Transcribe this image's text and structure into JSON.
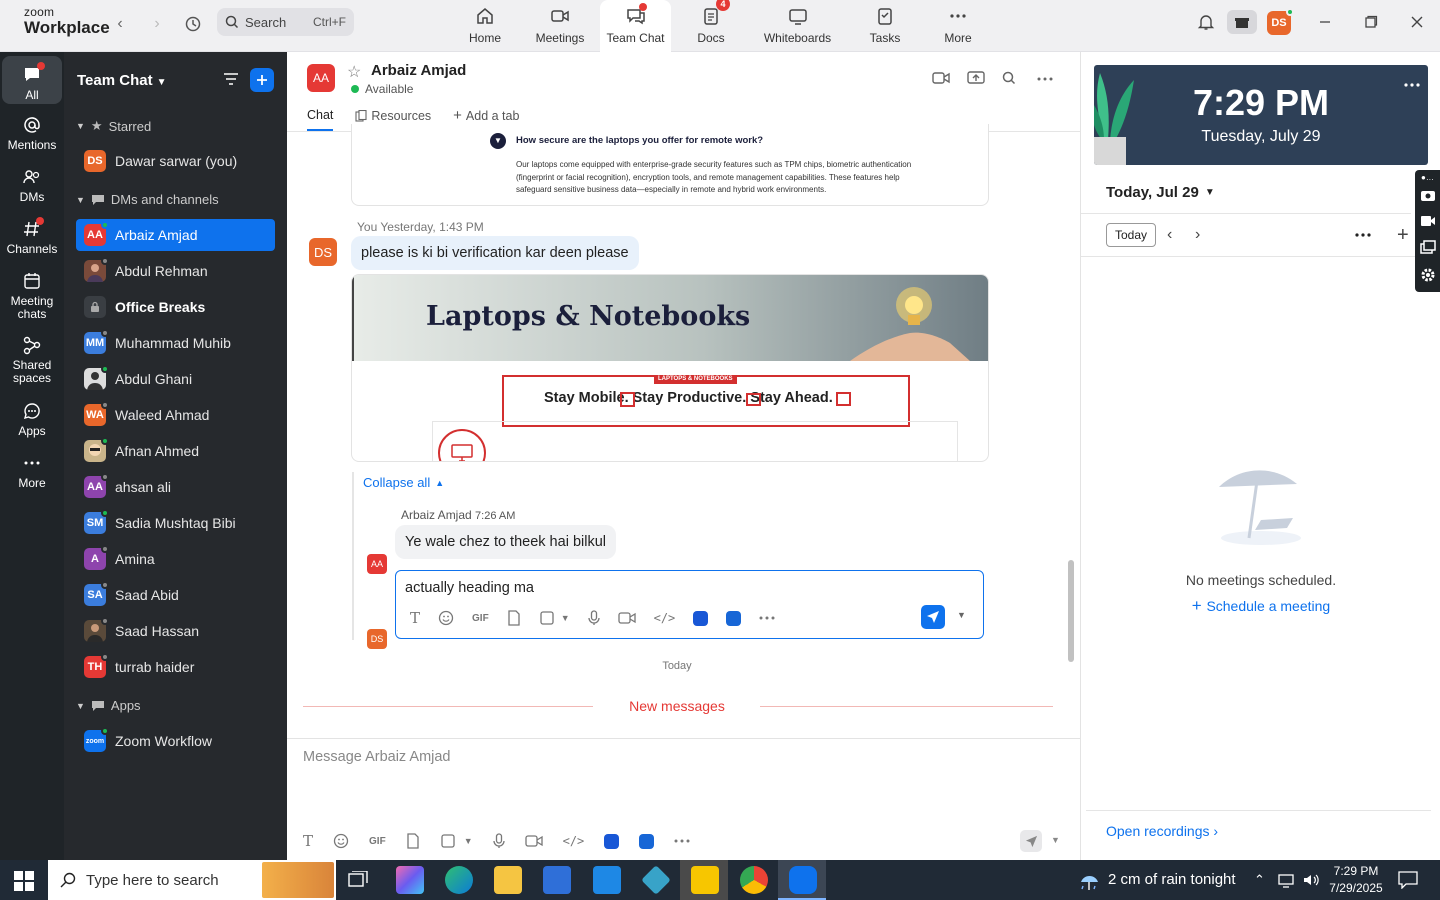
{
  "app": {
    "logo_line1": "zoom",
    "logo_line2": "Workplace",
    "search_placeholder": "Search",
    "search_shortcut": "Ctrl+F",
    "nav": [
      {
        "label": "Home"
      },
      {
        "label": "Meetings"
      },
      {
        "label": "Team Chat"
      },
      {
        "label": "Docs",
        "badge": "4"
      },
      {
        "label": "Whiteboards"
      },
      {
        "label": "Tasks"
      },
      {
        "label": "More"
      }
    ],
    "user_initials": "DS"
  },
  "rail": [
    {
      "label": "All"
    },
    {
      "label": "Mentions"
    },
    {
      "label": "DMs"
    },
    {
      "label": "Channels"
    },
    {
      "label_line1": "Meeting",
      "label_line2": "chats"
    },
    {
      "label_line1": "Shared",
      "label_line2": "spaces"
    },
    {
      "label": "Apps"
    },
    {
      "label": "More"
    }
  ],
  "channels": {
    "title": "Team Chat",
    "starred_label": "Starred",
    "starred": [
      {
        "initials": "DS",
        "name": "Dawar sarwar (you)",
        "color": "#e8672b"
      }
    ],
    "dms_label": "DMs and channels",
    "dms": [
      {
        "initials": "AA",
        "name": "Arbaiz Amjad",
        "color": "#e53935",
        "presence": "#1db954"
      },
      {
        "initials": "",
        "name": "Abdul Rehman",
        "color": "#7a4a3a",
        "presence": "#888"
      },
      {
        "initials": "",
        "name": "Office Breaks",
        "color": "#555",
        "bold": true
      },
      {
        "initials": "MM",
        "name": "Muhammad Muhib",
        "color": "#3b7ddd",
        "presence": "#888"
      },
      {
        "initials": "",
        "name": "Abdul Ghani",
        "color": "#ccc",
        "presence": "#1db954"
      },
      {
        "initials": "WA",
        "name": "Waleed Ahmad",
        "color": "#e8672b",
        "presence": "#888"
      },
      {
        "initials": "",
        "name": "Afnan Ahmed",
        "color": "#c9b48a",
        "presence": "#1db954"
      },
      {
        "initials": "AA",
        "name": "ahsan ali",
        "color": "#8e44ad",
        "presence": "#888"
      },
      {
        "initials": "SM",
        "name": "Sadia Mushtaq Bibi",
        "color": "#3b7ddd",
        "presence": "#1db954"
      },
      {
        "initials": "A",
        "name": "Amina",
        "color": "#8e44ad",
        "presence": "#888"
      },
      {
        "initials": "SA",
        "name": "Saad Abid",
        "color": "#3b7ddd",
        "presence": "#888"
      },
      {
        "initials": "",
        "name": "Saad Hassan",
        "color": "#5a4a3a",
        "presence": "#888"
      },
      {
        "initials": "TH",
        "name": "turrab haider",
        "color": "#e53935",
        "presence": "#888"
      }
    ],
    "apps_label": "Apps",
    "apps": [
      {
        "initials": "zoom",
        "name": "Zoom Workflow",
        "color": "#0e72ed",
        "presence": "#1db954"
      }
    ]
  },
  "chat": {
    "contact_initials": "AA",
    "contact_name": "Arbaiz Amjad",
    "contact_status": "Available",
    "tabs": [
      "Chat",
      "Resources",
      "Add a tab"
    ],
    "faq_question": "How secure are the laptops you offer for remote work?",
    "faq_answer": "Our laptops come equipped with enterprise-grade security features such as TPM chips, biometric authentication (fingerprint or facial recognition), encryption tools, and remote management capabilities. These features help safeguard sensitive business data—especially in remote and hybrid work environments.",
    "my_meta": "You Yesterday, 1:43 PM",
    "my_initials": "DS",
    "my_message": "please is ki bi verification kar deen please",
    "banner_title": "Laptops & Notebooks",
    "banner_small_tag": "LAPTOPS & NOTEBOOKS",
    "banner_tagline": "Stay Mobile. Stay Productive. Stay Ahead.",
    "collapse_label": "Collapse all",
    "reply_sender": "Arbaiz Amjad",
    "reply_time": "7:26 AM",
    "reply_message": "Ye wale chez to theek hai bilkul",
    "reply_draft": "actually heading ma",
    "today_label": "Today",
    "new_messages_label": "New messages",
    "composer_placeholder": "Message Arbaiz Amjad"
  },
  "calendar": {
    "time": "7:29 PM",
    "date": "Tuesday, July 29",
    "heading": "Today, Jul 29",
    "today_button": "Today",
    "empty_text": "No meetings scheduled.",
    "schedule_link": "Schedule a meeting",
    "open_recordings": "Open recordings"
  },
  "taskbar": {
    "search_placeholder": "Type here to search",
    "weather": "2 cm of rain tonight",
    "clock_time": "7:29 PM",
    "clock_date": "7/29/2025"
  },
  "colors": {
    "accent": "#0e72ed",
    "sidebar_dark": "#1f2428",
    "list_dark": "#26292d",
    "alert": "#e53935"
  }
}
